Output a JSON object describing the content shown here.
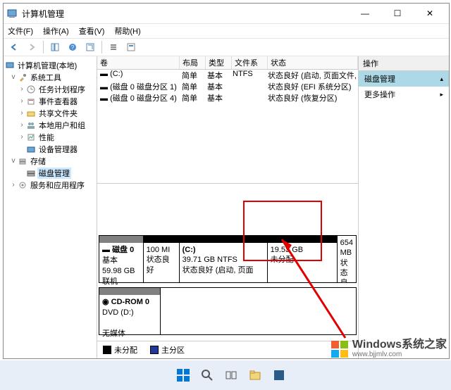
{
  "window": {
    "title": "计算机管理"
  },
  "menu": {
    "file": "文件(F)",
    "action": "操作(A)",
    "view": "查看(V)",
    "help": "帮助(H)"
  },
  "tree": {
    "root": "计算机管理(本地)",
    "systools": "系统工具",
    "scheduler": "任务计划程序",
    "eventvwr": "事件查看器",
    "shared": "共享文件夹",
    "users": "本地用户和组",
    "perf": "性能",
    "devmgr": "设备管理器",
    "storage": "存储",
    "diskmgmt": "磁盘管理",
    "services": "服务和应用程序"
  },
  "vol": {
    "hdr": {
      "volume": "卷",
      "layout": "布局",
      "type": "类型",
      "fs": "文件系统",
      "status": "状态"
    },
    "r0": {
      "vol": "(C:)",
      "lay": "简单",
      "typ": "基本",
      "fs": "NTFS",
      "st": "状态良好 (启动, 页面文件, 故障转储, 基本数据"
    },
    "r1": {
      "vol": "(磁盘 0 磁盘分区 1)",
      "lay": "简单",
      "typ": "基本",
      "fs": "",
      "st": "状态良好 (EFI 系统分区)"
    },
    "r2": {
      "vol": "(磁盘 0 磁盘分区 4)",
      "lay": "简单",
      "typ": "基本",
      "fs": "",
      "st": "状态良好 (恢复分区)"
    }
  },
  "disk0": {
    "label": "磁盘 0",
    "type": "基本",
    "size": "59.98 GB",
    "state": "联机",
    "p0": {
      "size": "100 MI",
      "st": "状态良好"
    },
    "p1": {
      "name": "(C:)",
      "size": "39.71 GB NTFS",
      "st": "状态良好 (启动, 页面"
    },
    "p2": {
      "size": "19.53 GB",
      "st": "未分配"
    },
    "p3": {
      "size": "654 MB",
      "st": "状态良好 (恢"
    }
  },
  "cdrom": {
    "label": "CD-ROM 0",
    "sub": "DVD (D:)",
    "state": "无媒体"
  },
  "legend": {
    "unalloc": "未分配",
    "primary": "主分区"
  },
  "actions": {
    "hdr": "操作",
    "diskmgmt": "磁盘管理",
    "more": "更多操作"
  },
  "watermark": {
    "text": "Windows系统之家",
    "url": "www.bjjmlv.com"
  }
}
